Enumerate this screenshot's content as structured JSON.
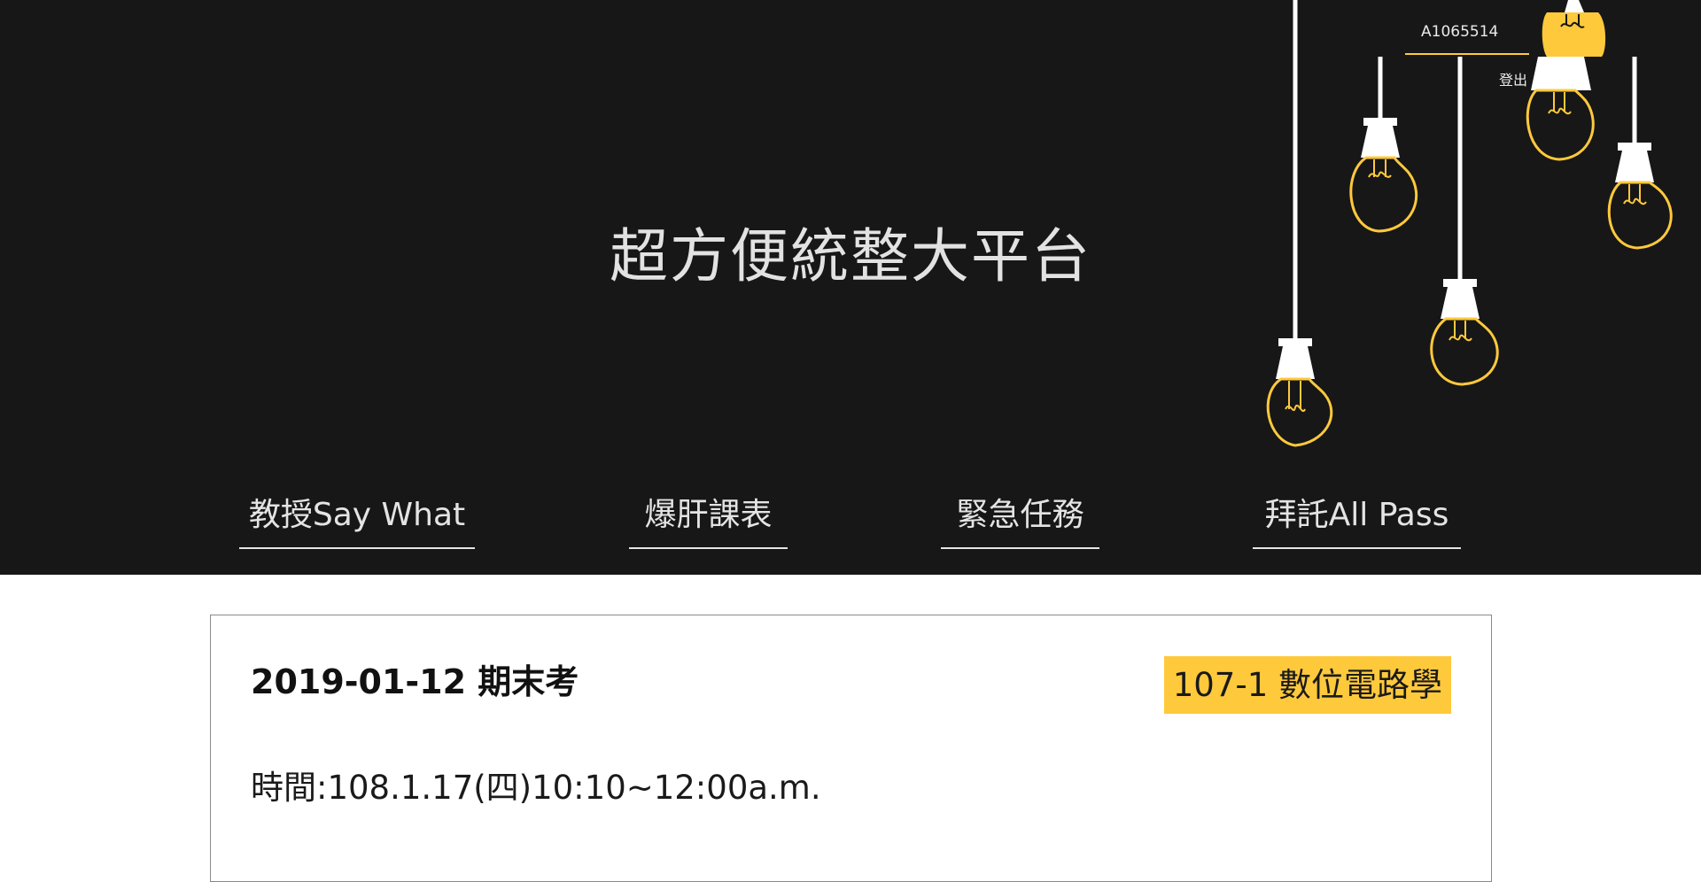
{
  "header": {
    "title": "超方便統整大平台",
    "user_id": "A1065514",
    "logout_label": "登出"
  },
  "nav": {
    "items": [
      {
        "label": "教授Say What"
      },
      {
        "label": "爆肝課表"
      },
      {
        "label": "緊急任務"
      },
      {
        "label": "拜託All Pass"
      }
    ]
  },
  "card": {
    "exam_title": "2019-01-12 期末考",
    "course_badge": "107-1 數位電路學",
    "time_text": "時間:108.1.17(四)10:10~12:00a.m."
  },
  "colors": {
    "header_bg": "#171717",
    "accent_yellow": "#ffc93c",
    "text_light": "#e4e4e4"
  }
}
